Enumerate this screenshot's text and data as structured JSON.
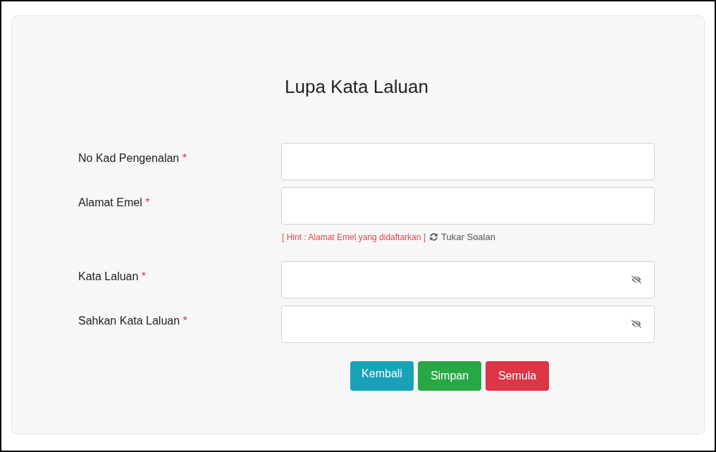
{
  "title": "Lupa Kata Laluan",
  "fields": [
    {
      "label": "No Kad Pengenalan",
      "required_mark": "*",
      "kind": "text"
    },
    {
      "label": "Alamat Emel",
      "required_mark": "*",
      "kind": "text",
      "hint": "[ Hint : Alamat Emel yang didaftarkan ]",
      "hint_action": "Tukar Soalan"
    },
    {
      "label": "Kata Laluan",
      "required_mark": "*",
      "kind": "password"
    },
    {
      "label": "Sahkan Kata Laluan",
      "required_mark": "*",
      "kind": "password"
    }
  ],
  "buttons": [
    {
      "label": "Kembali",
      "kind": "info"
    },
    {
      "label": "Simpan",
      "kind": "success"
    },
    {
      "label": "Semula",
      "kind": "danger"
    }
  ]
}
